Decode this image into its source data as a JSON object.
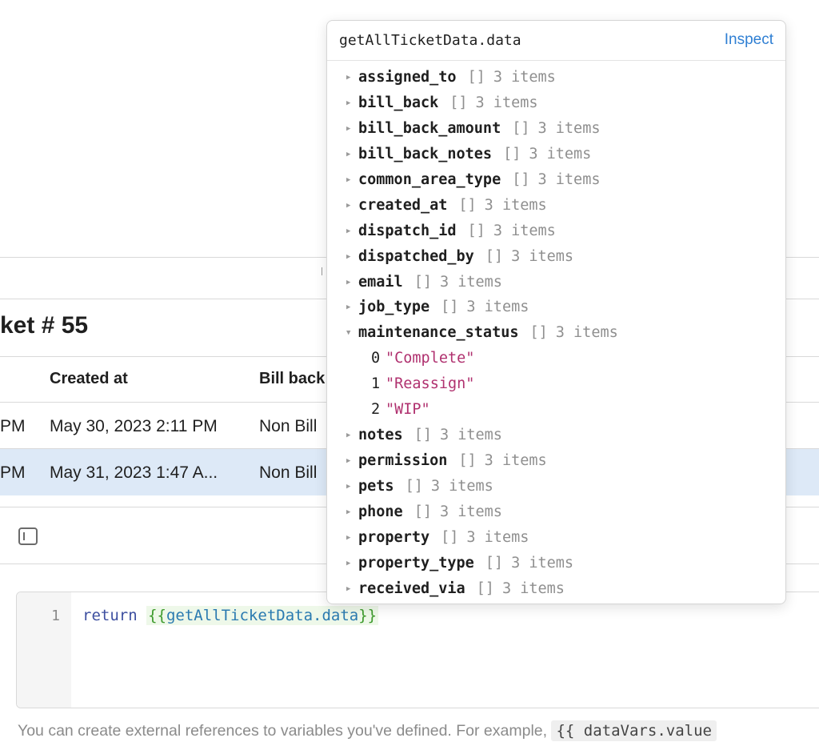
{
  "page": {
    "title": "ket # 55"
  },
  "table": {
    "headers": [
      "Created at",
      "Bill back"
    ],
    "rows": [
      {
        "time_fragment": "PM",
        "created_at": "May 30, 2023 2:11 PM",
        "bill_back": "Non Bill"
      },
      {
        "time_fragment": "PM",
        "created_at": "May 31, 2023 1:47 A...",
        "bill_back": "Non Bill"
      }
    ]
  },
  "editor": {
    "line_number": "1",
    "keyword": "return",
    "template_open": "{{",
    "reference": "getAllTicketData.data",
    "template_close": "}}"
  },
  "helper": {
    "text": "You can create external references to variables you've defined. For example,",
    "code": "{{ dataVars.value"
  },
  "popover": {
    "title": "getAllTicketData.data",
    "inspect_label": "Inspect",
    "bracket": "[]",
    "items": [
      {
        "key": "assigned_to",
        "count": "3 items"
      },
      {
        "key": "bill_back",
        "count": "3 items"
      },
      {
        "key": "bill_back_amount",
        "count": "3 items"
      },
      {
        "key": "bill_back_notes",
        "count": "3 items"
      },
      {
        "key": "common_area_type",
        "count": "3 items"
      },
      {
        "key": "created_at",
        "count": "3 items"
      },
      {
        "key": "dispatch_id",
        "count": "3 items"
      },
      {
        "key": "dispatched_by",
        "count": "3 items"
      },
      {
        "key": "email",
        "count": "3 items"
      },
      {
        "key": "job_type",
        "count": "3 items"
      },
      {
        "key": "maintenance_status",
        "count": "3 items",
        "children": [
          {
            "index": "0",
            "value": "\"Complete\""
          },
          {
            "index": "1",
            "value": "\"Reassign\""
          },
          {
            "index": "2",
            "value": "\"WIP\""
          }
        ]
      },
      {
        "key": "notes",
        "count": "3 items"
      },
      {
        "key": "permission",
        "count": "3 items"
      },
      {
        "key": "pets",
        "count": "3 items"
      },
      {
        "key": "phone",
        "count": "3 items"
      },
      {
        "key": "property",
        "count": "3 items"
      },
      {
        "key": "property_type",
        "count": "3 items"
      },
      {
        "key": "received_via",
        "count": "3 items"
      }
    ]
  },
  "icons": {
    "collapsed": "caret-right-icon",
    "expanded": "caret-down-icon",
    "sidebar": "sidebar-toggle-icon"
  },
  "colors": {
    "accent": "#2f7fd3",
    "selected_row": "#dde9f7",
    "string_value": "#b0316f",
    "template_text": "#3c9a2b"
  }
}
